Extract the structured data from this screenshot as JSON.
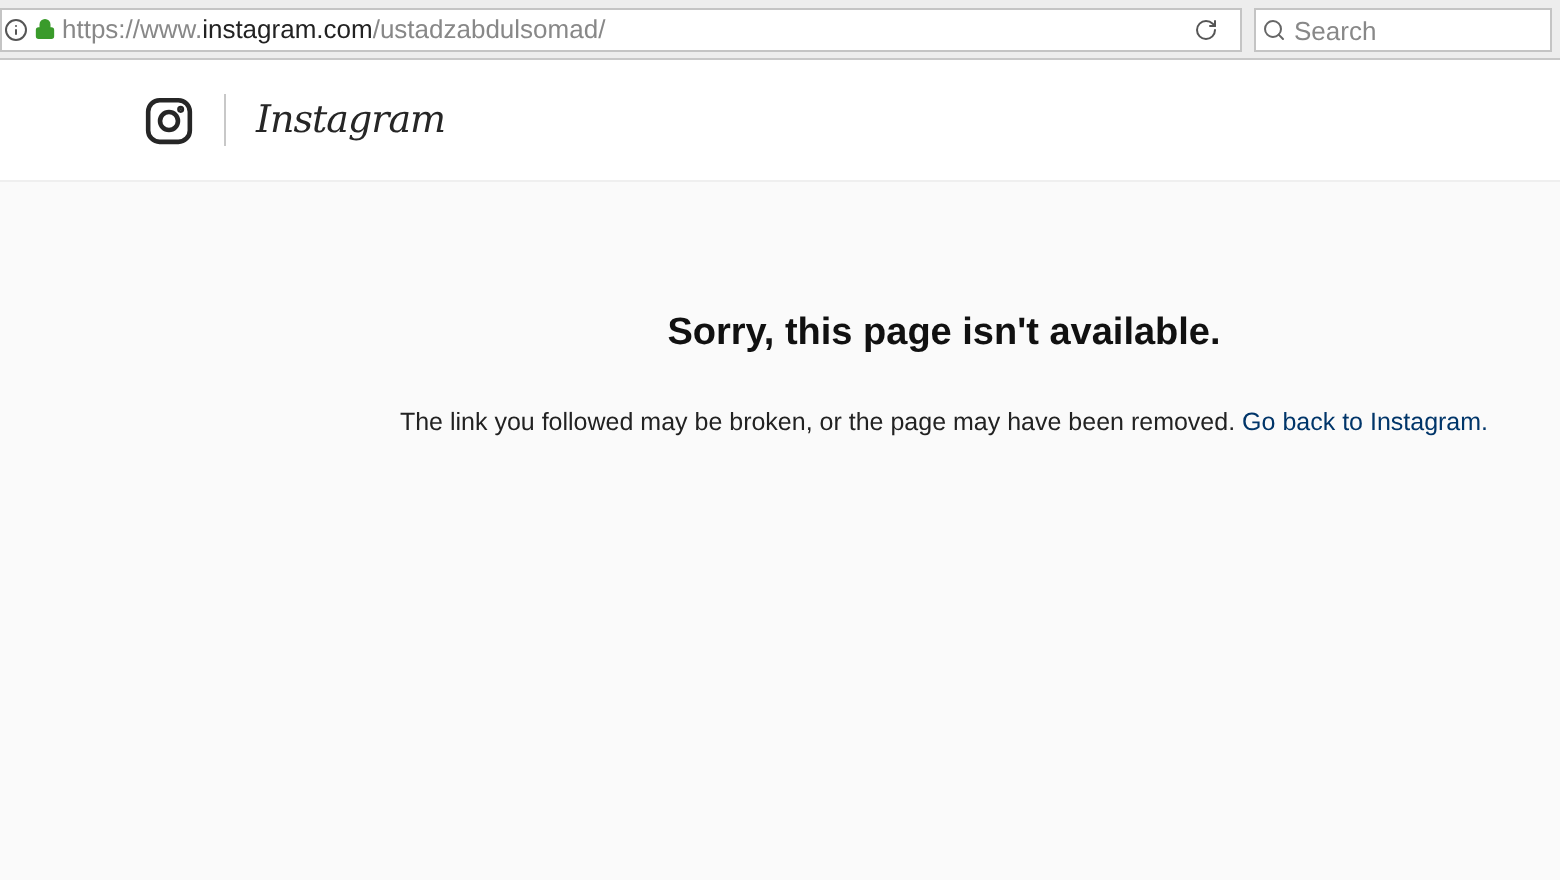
{
  "browser": {
    "url": {
      "scheme": "https://www.",
      "domain": "instagram.com",
      "path": "/ustadzabdulsomad/"
    },
    "search": {
      "placeholder": "Search"
    }
  },
  "header": {
    "wordmark": "Instagram"
  },
  "error": {
    "title": "Sorry, this page isn't available.",
    "message": "The link you followed may be broken, or the page may have been removed.",
    "link": "Go back to Instagram."
  }
}
